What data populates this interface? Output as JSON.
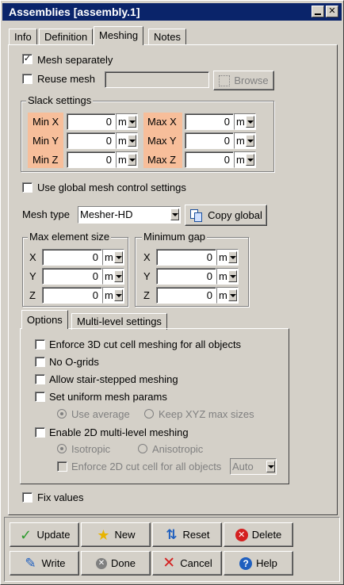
{
  "window": {
    "title": "Assemblies [assembly.1]"
  },
  "tabs": [
    "Info",
    "Definition",
    "Meshing",
    "Notes"
  ],
  "mesh_separately": {
    "label": "Mesh separately",
    "checked": true
  },
  "reuse_mesh": {
    "label": "Reuse mesh",
    "checked": false,
    "value": "",
    "browse": "Browse"
  },
  "slack": {
    "title": "Slack settings",
    "rows": [
      {
        "min_label": "Min X",
        "min_value": "0",
        "min_unit": "m",
        "max_label": "Max X",
        "max_value": "0",
        "max_unit": "m"
      },
      {
        "min_label": "Min Y",
        "min_value": "0",
        "min_unit": "m",
        "max_label": "Max Y",
        "max_value": "0",
        "max_unit": "m"
      },
      {
        "min_label": "Min Z",
        "min_value": "0",
        "min_unit": "m",
        "max_label": "Max Z",
        "max_value": "0",
        "max_unit": "m"
      }
    ]
  },
  "global_mesh": {
    "label": "Use global mesh control settings",
    "checked": false
  },
  "mesh_type": {
    "label": "Mesh type",
    "value": "Mesher-HD",
    "copy": "Copy global"
  },
  "max_element": {
    "title": "Max element size",
    "rows": [
      {
        "label": "X",
        "value": "0",
        "unit": "m"
      },
      {
        "label": "Y",
        "value": "0",
        "unit": "m"
      },
      {
        "label": "Z",
        "value": "0",
        "unit": "m"
      }
    ]
  },
  "min_gap": {
    "title": "Minimum gap",
    "rows": [
      {
        "label": "X",
        "value": "0",
        "unit": "m"
      },
      {
        "label": "Y",
        "value": "0",
        "unit": "m"
      },
      {
        "label": "Z",
        "value": "0",
        "unit": "m"
      }
    ]
  },
  "subtabs": [
    "Options",
    "Multi-level settings"
  ],
  "options": {
    "enforce3d": "Enforce 3D cut cell meshing for all objects",
    "no_ogrids": "No O-grids",
    "stair": "Allow stair-stepped meshing",
    "uniform": "Set uniform mesh params",
    "use_average": "Use average",
    "keep_xyz": "Keep XYZ max sizes",
    "enable2d": "Enable 2D multi-level meshing",
    "isotropic": "Isotropic",
    "anisotropic": "Anisotropic",
    "enforce2d": "Enforce 2D cut cell for all objects",
    "auto": "Auto"
  },
  "fix_values": {
    "label": "Fix values",
    "checked": false
  },
  "buttons": {
    "update": "Update",
    "new": "New",
    "reset": "Reset",
    "delete": "Delete",
    "write": "Write",
    "done": "Done",
    "cancel": "Cancel",
    "help": "Help"
  },
  "colors": {
    "title_bg": "#0a246a",
    "slack_highlight": "#f7be9a",
    "face": "#d4d0c8"
  }
}
